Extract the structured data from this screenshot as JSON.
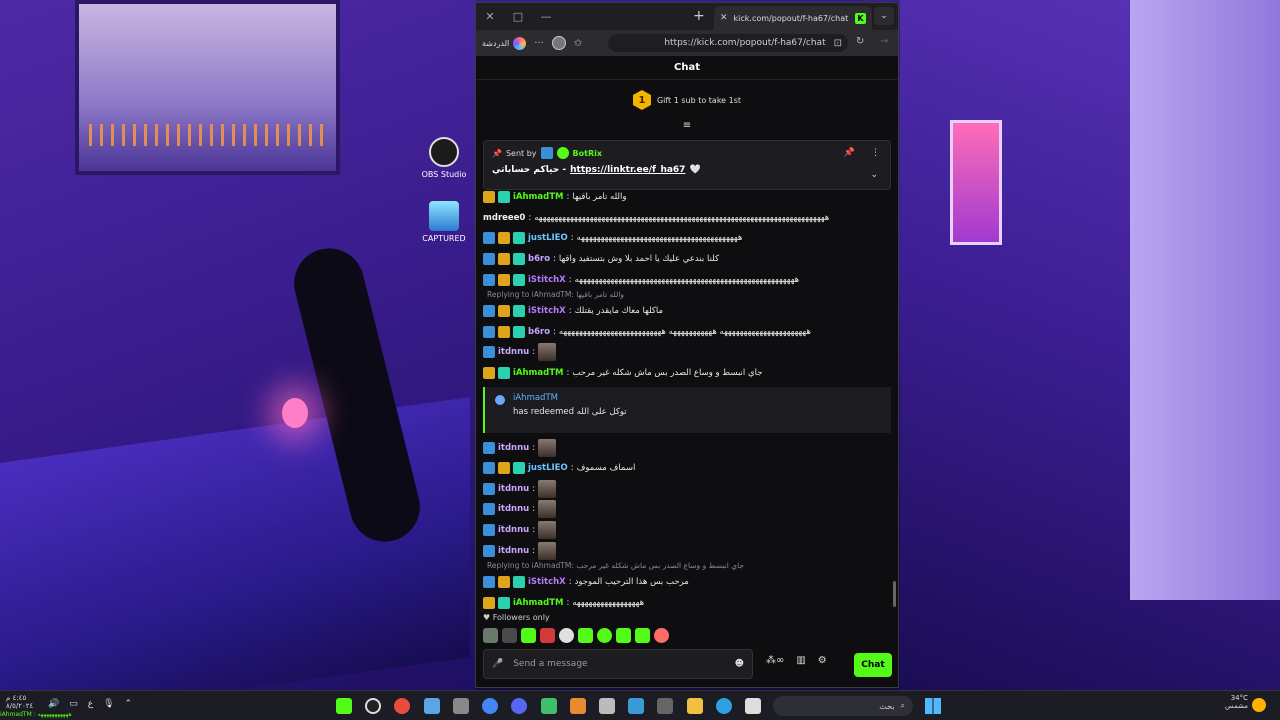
{
  "desktop": {
    "icons": [
      {
        "label": "OBS Studio"
      },
      {
        "label": "CAPTURED"
      }
    ]
  },
  "browser": {
    "tab_title": "kick.com/popout/f-ha67/chat",
    "address_chat_label": "الدردشة",
    "url": "https://kick.com/popout/f-ha67/chat"
  },
  "chat": {
    "header": "Chat",
    "gift": {
      "badge": "1",
      "text": "Gift 1 sub to take 1st"
    },
    "pinned": {
      "sent_by": "Sent by",
      "bot_name": "BotRix",
      "prefix": "حياكم حساباتي -",
      "link": "https://linktr.ee/f_ha67",
      "heart": "🤍"
    },
    "messages": [
      {
        "user": "iAhmadTM",
        "text": "والله تامر باقيها"
      },
      {
        "user": "mdreee0",
        "text": "ههههههههههههههههههههههههههههههههههههههههههههههههههههههههههههههههههههههههههه"
      },
      {
        "user": "justLIEO",
        "text": "هههههههههههههههههههههههههههههههههههههههههه"
      },
      {
        "user": "b6ro",
        "text": "كلنا بندعي عليك يا احمد بلا وش بتستفيد واقها"
      },
      {
        "user": "iStitchX",
        "text": "ههههههههههههههههههههههههههههههههههههههههههههههههههههههههه"
      },
      {
        "reply_to": "Replying to iAhmadTM: والله تامر باقيها"
      },
      {
        "user": "iStitchX",
        "text": "ماكلها معاك مايقدر يقتلك"
      },
      {
        "user": "b6ro",
        "text": "ههههههههههههههههههههههه هههههههههههه ههههههههههههههههههههههههههه"
      },
      {
        "user": "itdnnu",
        "text": ""
      },
      {
        "user": "iAhmadTM",
        "text": "جاي انبسط و وساع الصدر بس ماش شكله غير مرحب"
      },
      {
        "redeem_user": "iAhmadTM",
        "redeem_text": "has redeemed توكل على الله"
      },
      {
        "user": "itdnnu",
        "text": ""
      },
      {
        "user": "justLIEO",
        "text": "اسماف مسموف"
      },
      {
        "user": "itdnnu",
        "text": ""
      },
      {
        "user": "itdnnu",
        "text": ""
      },
      {
        "user": "itdnnu",
        "text": ""
      },
      {
        "user": "itdnnu",
        "text": ""
      },
      {
        "reply_to": "Replying to iAhmadTM: جاي انبسط و وساع الصدر بس ماش شكله غير مرحب"
      },
      {
        "user": "iStitchX",
        "text": "مرحب بس هذا الترحيب الموجود"
      },
      {
        "user": "iAhmadTM",
        "text": "هههههههههههههههههه"
      }
    ],
    "followers_only": "Followers only",
    "input_placeholder": "Send a message",
    "send_button": "Chat"
  },
  "taskbar": {
    "search_placeholder": "بحث",
    "weather_temp": "34°C",
    "weather_desc": "مشمس",
    "clock_time": "٤:٤٥ م",
    "clock_date": "٨/٥/٢٠٢٤",
    "lang": "ع",
    "ticker": "iAhmadTM : هههههههههههه"
  },
  "colors": {
    "kick_green": "#53fc18",
    "background": "#0e0e10"
  }
}
